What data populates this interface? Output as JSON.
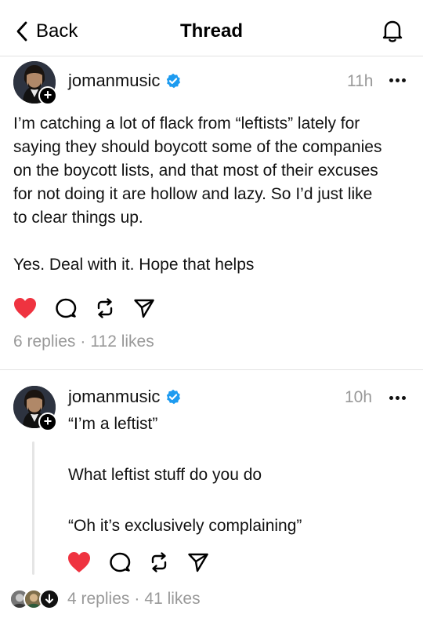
{
  "header": {
    "back_label": "Back",
    "title": "Thread"
  },
  "post": {
    "username": "jomanmusic",
    "time": "11h",
    "text": "I’m catching a lot of flack from “leftists” lately for\nsaying they should boycott some of the companies\non the boycott lists, and that most of their excuses\nfor not doing it are hollow and lazy. So I’d just like\nto clear things up.\n\nYes. Deal with it. Hope that helps",
    "replies": "6 replies",
    "likes": "112 likes",
    "liked": true
  },
  "reply": {
    "username": "jomanmusic",
    "time": "10h",
    "text": "“I’m a leftist”\n\nWhat leftist stuff do you do\n\n“Oh it’s exclusively complaining”",
    "replies": "4 replies",
    "likes": "41 likes",
    "liked": true
  },
  "colors": {
    "like_red": "#ef3340",
    "verified_blue": "#1d9bf0",
    "muted_text": "#999999"
  },
  "icons": [
    "chevron-left-icon",
    "bell-icon",
    "verified-icon",
    "more-icon",
    "heart-icon",
    "comment-icon",
    "repost-icon",
    "share-icon",
    "plus-icon",
    "down-arrow-icon"
  ]
}
